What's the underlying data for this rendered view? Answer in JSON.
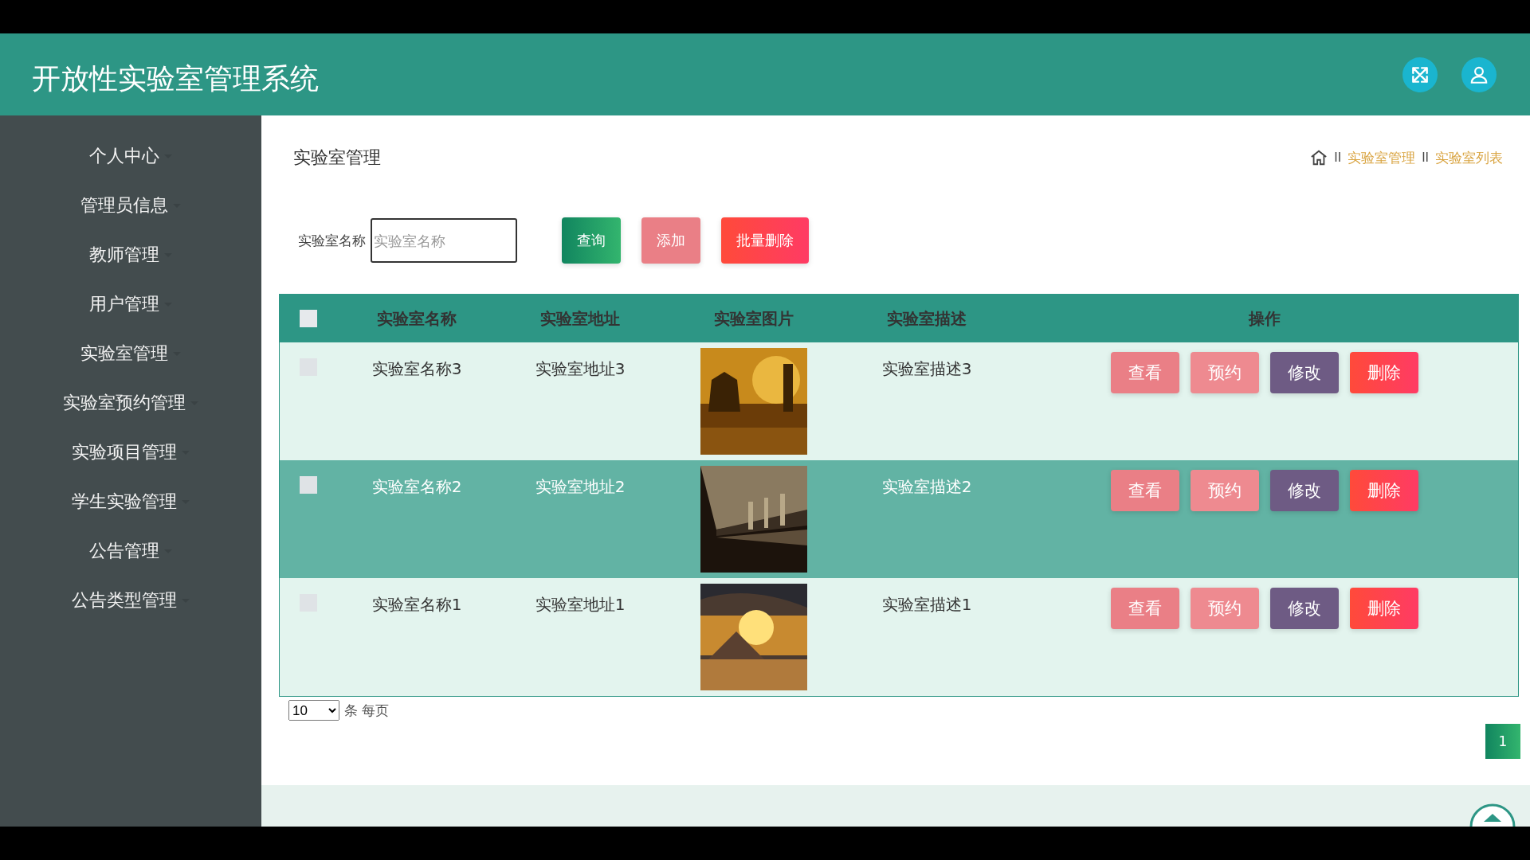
{
  "header": {
    "title": "开放性实验室管理系统"
  },
  "sidebar": {
    "items": [
      {
        "label": "个人中心"
      },
      {
        "label": "管理员信息"
      },
      {
        "label": "教师管理"
      },
      {
        "label": "用户管理"
      },
      {
        "label": "实验室管理"
      },
      {
        "label": "实验室预约管理"
      },
      {
        "label": "实验项目管理"
      },
      {
        "label": "学生实验管理"
      },
      {
        "label": "公告管理"
      },
      {
        "label": "公告类型管理"
      }
    ]
  },
  "page_title": "实验室管理",
  "breadcrumb": {
    "items": [
      {
        "separator": "II",
        "label": "实验室管理"
      },
      {
        "separator": "II",
        "label": "实验室列表"
      }
    ]
  },
  "search": {
    "label": "实验室名称",
    "placeholder": "实验室名称",
    "buttons": [
      {
        "label": "查询",
        "kind": "search"
      },
      {
        "label": "添加",
        "kind": "add"
      },
      {
        "label": "批量删除",
        "kind": "batch-delete"
      }
    ]
  },
  "table": {
    "select_all": {
      "checked": false
    },
    "columns": [
      "实验室名称",
      "实验室地址",
      "实验室图片",
      "实验室描述",
      "操作"
    ],
    "rows": [
      {
        "name": "实验室名称3",
        "address": "实验室地址3",
        "picture": {
          "kind": "picture"
        },
        "description": "实验室描述3",
        "checked": false,
        "selected": false,
        "actions": [
          {
            "label": "查看",
            "kind": "view"
          },
          {
            "label": "预约",
            "kind": "book"
          },
          {
            "label": "修改",
            "kind": "edit"
          },
          {
            "label": "删除",
            "kind": "delete"
          }
        ]
      },
      {
        "name": "实验室名称2",
        "address": "实验室地址2",
        "picture": {
          "kind": "picture"
        },
        "description": "实验室描述2",
        "checked": false,
        "selected": true,
        "actions": [
          {
            "label": "查看",
            "kind": "view"
          },
          {
            "label": "预约",
            "kind": "book"
          },
          {
            "label": "修改",
            "kind": "edit"
          },
          {
            "label": "删除",
            "kind": "delete"
          }
        ]
      },
      {
        "name": "实验室名称1",
        "address": "实验室地址1",
        "picture": {
          "kind": "picture"
        },
        "description": "实验室描述1",
        "checked": false,
        "selected": false,
        "actions": [
          {
            "label": "查看",
            "kind": "view"
          },
          {
            "label": "预约",
            "kind": "book"
          },
          {
            "label": "修改",
            "kind": "edit"
          },
          {
            "label": "删除",
            "kind": "delete"
          }
        ]
      }
    ]
  },
  "pagination": {
    "page_size": "10",
    "page_size_suffix": "条 每页",
    "pages": [
      {
        "label": "1",
        "selected": true
      }
    ]
  }
}
